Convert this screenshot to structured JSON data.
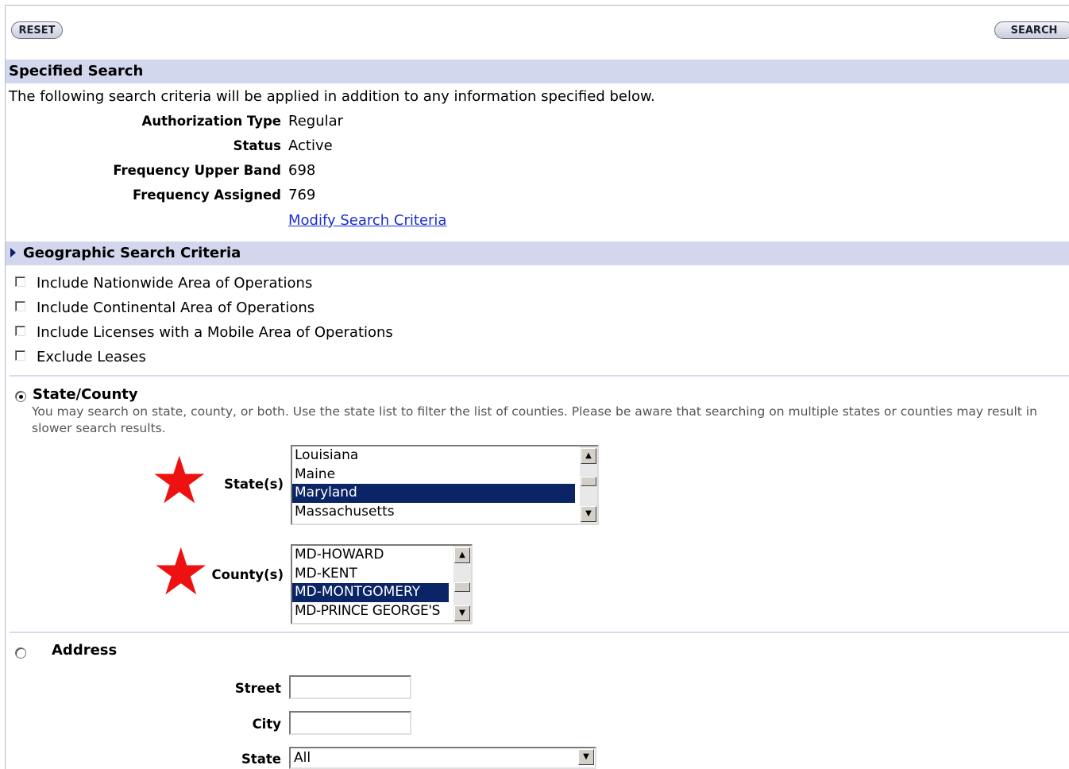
{
  "toolbar": {
    "reset_label": "RESET",
    "search_label": "SEARCH"
  },
  "specified": {
    "title": "Specified Search",
    "intro": "The following search criteria will be applied in addition to any information specified below.",
    "rows": [
      {
        "label": "Authorization Type",
        "value": "Regular"
      },
      {
        "label": "Status",
        "value": "Active"
      },
      {
        "label": "Frequency Upper Band",
        "value": "698"
      },
      {
        "label": "Frequency Assigned",
        "value": "769"
      }
    ],
    "modify_link": "Modify Search Criteria"
  },
  "geo": {
    "title": "Geographic Search Criteria",
    "expander_icon": "triangle-right-icon",
    "checkboxes": [
      {
        "label": "Include Nationwide Area of Operations",
        "checked": false
      },
      {
        "label": "Include Continental Area of Operations",
        "checked": false
      },
      {
        "label": "Include Licenses with a Mobile Area of Operations",
        "checked": false
      },
      {
        "label": "Exclude Leases",
        "checked": false
      }
    ],
    "state_county": {
      "label": "State/County",
      "selected": true,
      "help": "You may search on state, county, or both. Use the state list to filter the list of counties. Please be aware that searching on multiple states or counties may result in slower search results.",
      "states_label": "State(s)",
      "states": [
        "Louisiana",
        "Maine",
        "Maryland",
        "Massachusetts"
      ],
      "states_selected": "Maryland",
      "counties_label": "County(s)",
      "counties": [
        "MD-HOWARD",
        "MD-KENT",
        "MD-MONTGOMERY",
        "MD-PRINCE GEORGE'S"
      ],
      "counties_selected": "MD-MONTGOMERY",
      "annotation_icon": "red-star-icon"
    },
    "address": {
      "label": "Address",
      "selected": false,
      "street_label": "Street",
      "street_value": "",
      "city_label": "City",
      "city_value": "",
      "state_label": "State",
      "state_value": "All"
    }
  },
  "colors": {
    "band": "#d2d7ee",
    "selection": "#0b2466",
    "link": "#1a2fd0",
    "star": "#ee1111"
  }
}
